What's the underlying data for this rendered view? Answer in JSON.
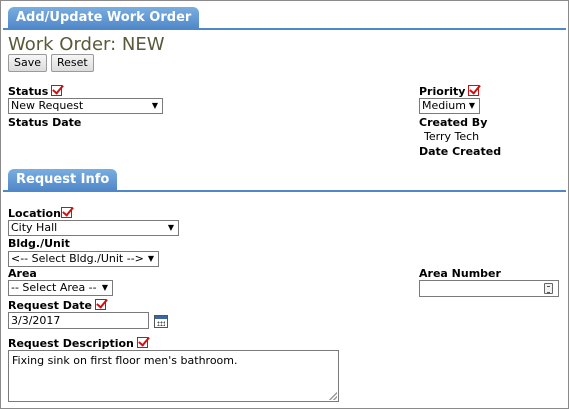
{
  "header": {
    "title": "Add/Update Work Order"
  },
  "work_order": {
    "title": "Work Order: NEW"
  },
  "buttons": {
    "save": "Save",
    "reset": "Reset"
  },
  "status": {
    "label": "Status",
    "value": "New Request",
    "date_label": "Status Date"
  },
  "priority": {
    "label": "Priority",
    "value": "Medium"
  },
  "created_by": {
    "label": "Created By",
    "value": "Terry Tech"
  },
  "date_created": {
    "label": "Date Created"
  },
  "request_info": {
    "title": "Request Info"
  },
  "location": {
    "label": "Location",
    "value": "City Hall"
  },
  "bldg_unit": {
    "label": "Bldg./Unit",
    "value": "<-- Select Bldg./Unit -->"
  },
  "area": {
    "label": "Area",
    "value": "-- Select Area --"
  },
  "area_number": {
    "label": "Area Number",
    "value": ""
  },
  "request_date": {
    "label": "Request Date",
    "value": "3/3/2017"
  },
  "request_description": {
    "label": "Request Description",
    "value": "Fixing sink on first floor men's bathroom."
  },
  "icons": {
    "required": "required-check-icon",
    "calendar": "calendar-icon",
    "calculator": "calculator-icon",
    "dropdown": "chevron-down-icon"
  },
  "colors": {
    "header_blue": "#4f87c8",
    "required_red": "#d01010",
    "title_olive": "#5a5a3a"
  }
}
